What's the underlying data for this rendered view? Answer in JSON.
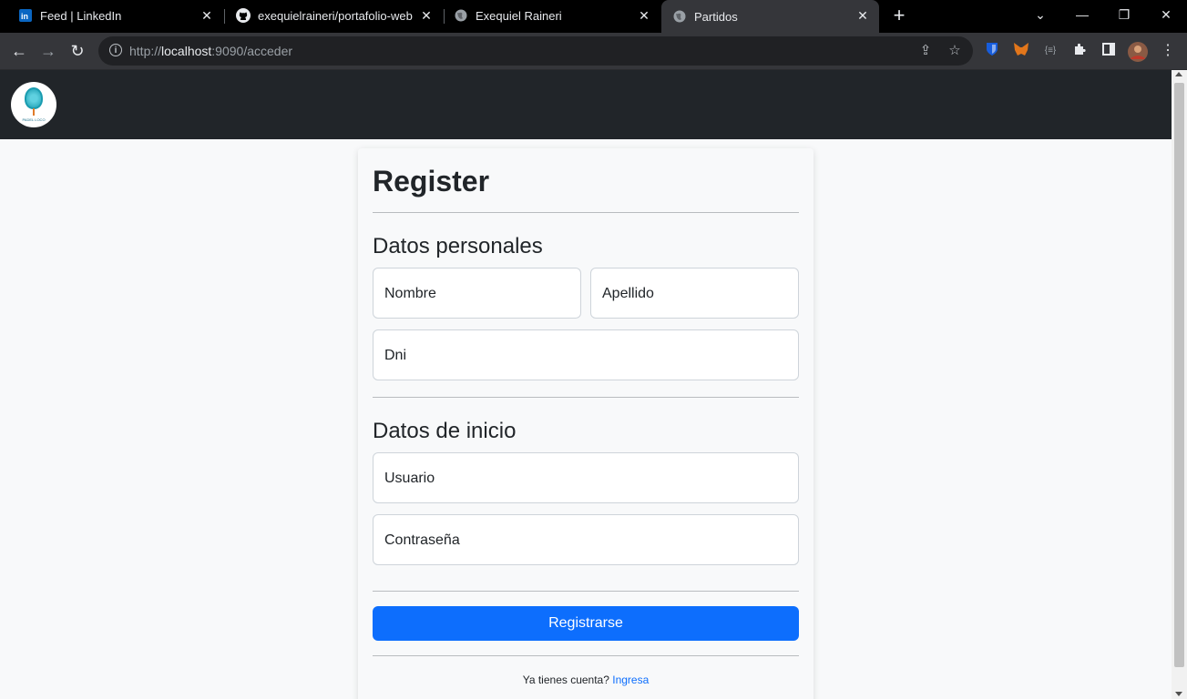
{
  "tabs": [
    {
      "title": "Feed | LinkedIn",
      "icon": "linkedin-icon",
      "active": false
    },
    {
      "title": "exequielraineri/portafolio-web",
      "icon": "github-icon",
      "active": false
    },
    {
      "title": "Exequiel Raineri",
      "icon": "globe-icon",
      "active": false
    },
    {
      "title": "Partidos",
      "icon": "globe-icon",
      "active": true
    }
  ],
  "toolbar": {
    "url_prefix": "http://",
    "url_host": "localhost",
    "url_rest": ":9090/acceder"
  },
  "logo": {
    "text": "PADEL LOCO"
  },
  "form": {
    "title": "Register",
    "section_personal": "Datos personales",
    "nombre_placeholder": "Nombre",
    "apellido_placeholder": "Apellido",
    "dni_placeholder": "Dni",
    "section_login": "Datos de inicio",
    "usuario_placeholder": "Usuario",
    "password_placeholder": "Contraseña",
    "submit_label": "Registrarse",
    "footer_text": "Ya tienes cuenta?",
    "footer_link": "Ingresa"
  },
  "colors": {
    "primary": "#0d6efd",
    "navbar": "#212529",
    "page_bg": "#f8f9fa"
  }
}
